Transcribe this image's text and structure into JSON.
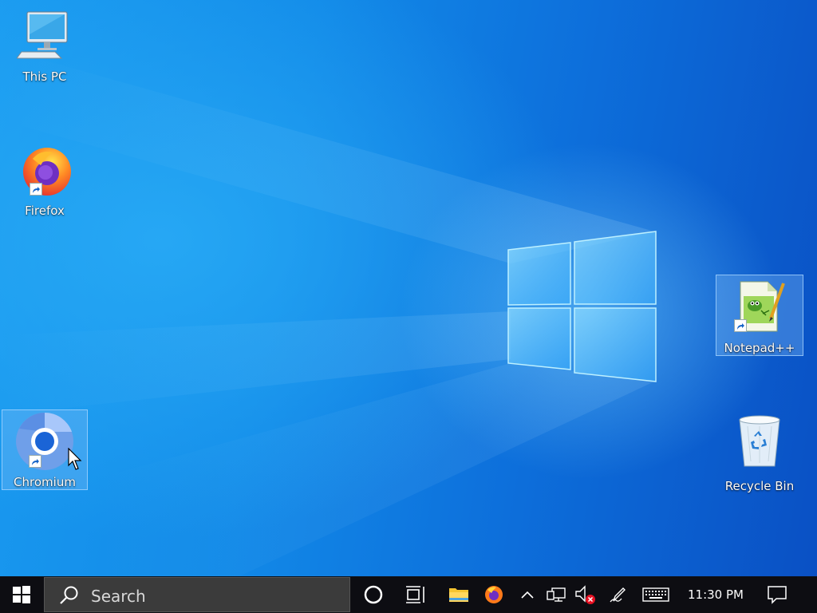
{
  "desktop": {
    "icons": [
      {
        "label": "This PC",
        "icon": "computer-icon",
        "shortcut": false,
        "selected": false
      },
      {
        "label": "Firefox",
        "icon": "firefox-icon",
        "shortcut": true,
        "selected": false
      },
      {
        "label": "Chromium",
        "icon": "chromium-icon",
        "shortcut": true,
        "selected": true
      },
      {
        "label": "Notepad++",
        "icon": "notepadpp-icon",
        "shortcut": true,
        "selected": true
      },
      {
        "label": "Recycle Bin",
        "icon": "recycle-bin-icon",
        "shortcut": false,
        "selected": false
      }
    ],
    "colors": {
      "accent": "#0a6fd8",
      "selection": "#82bef5"
    }
  },
  "taskbar": {
    "start_icon": "windows-logo-icon",
    "search": {
      "placeholder": "Search",
      "icon": "search-icon"
    },
    "cortana_icon": "cortana-icon",
    "task_view_icon": "task-view-icon",
    "pinned": [
      {
        "name": "File Explorer",
        "icon": "folder-icon"
      },
      {
        "name": "Firefox",
        "icon": "firefox-icon"
      }
    ],
    "tray": {
      "overflow_icon": "chevron-up-icon",
      "network_icon": "network-icon",
      "volume_icon": "volume-muted-icon",
      "pen_icon": "pen-icon",
      "keyboard_icon": "keyboard-icon",
      "clock": "11:30 PM",
      "notifications_icon": "action-center-icon"
    },
    "colors": {
      "background": "#0d0d12"
    }
  }
}
